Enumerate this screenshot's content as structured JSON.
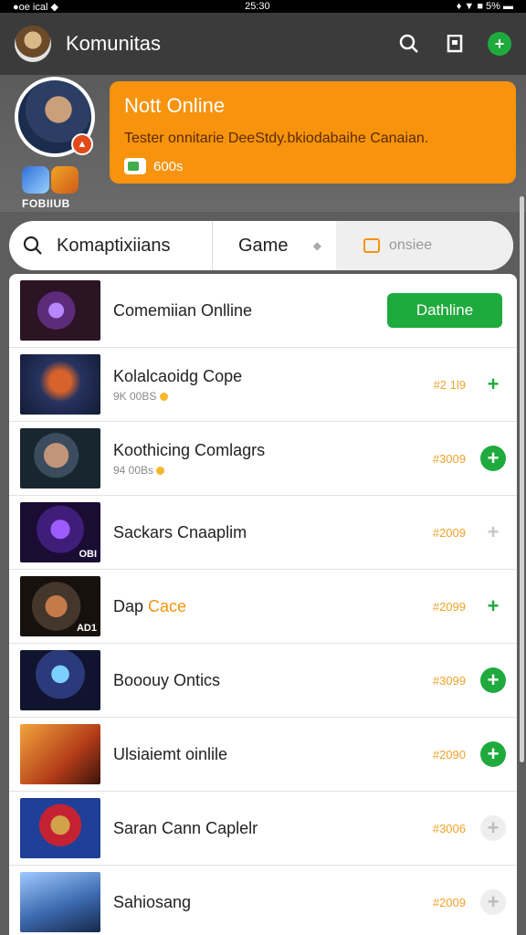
{
  "statusbar": {
    "left": "●oe ical ◆",
    "center": "25:30",
    "right": "♦ ▼ ■ 5% ▬"
  },
  "app": {
    "title": "Komunitas"
  },
  "header_icons": [
    "search-icon",
    "bookmark-icon",
    "add-icon"
  ],
  "profile": {
    "caption": "FOBIIUB",
    "badge_icon": "fire-icon"
  },
  "banner": {
    "title": "Nott Online",
    "text": "Tester onnitarie DeeStdy.bkiodabaihe Canaian.",
    "count": "600s"
  },
  "search": {
    "query": "Komaptixiians",
    "game_label": "Game",
    "caret": "◆",
    "online_label": "onsiee"
  },
  "list": [
    {
      "title": "Comemiian Onlline",
      "title_hl": "",
      "sub": "",
      "meta": "",
      "action": "Dathline",
      "action_type": "button",
      "thumb_tag": ""
    },
    {
      "title": "Kolalcaoidg Cope",
      "title_hl": "",
      "sub": "9K 00BS",
      "meta": "#2 1l9",
      "action": "+",
      "action_type": "plain",
      "thumb_tag": ""
    },
    {
      "title": "Koothicing Comlagrs",
      "title_hl": "",
      "sub": "94 00Bs",
      "meta": "#3009",
      "action": "+",
      "action_type": "filled",
      "thumb_tag": ""
    },
    {
      "title": "Sackars Cnaaplim",
      "title_hl": "",
      "sub": "",
      "meta": "#2009",
      "action": "+",
      "action_type": "grey",
      "thumb_tag": "OBI"
    },
    {
      "title": "Dap ",
      "title_hl": "Cace",
      "sub": "",
      "meta": "#2099",
      "action": "+",
      "action_type": "plain",
      "thumb_tag": "AD1"
    },
    {
      "title": "Booouy Ontics",
      "title_hl": "",
      "sub": "",
      "meta": "#3099",
      "action": "+",
      "action_type": "filled",
      "thumb_tag": ""
    },
    {
      "title": "Ulsiaiemt oinlile",
      "title_hl": "",
      "sub": "",
      "meta": "#2090",
      "action": "+",
      "action_type": "filled",
      "thumb_tag": ""
    },
    {
      "title": "Saran Cann Caplelr",
      "title_hl": "",
      "sub": "",
      "meta": "#3006",
      "action": "+",
      "action_type": "grey-filled",
      "thumb_tag": ""
    },
    {
      "title": "Sahiosang",
      "title_hl": "",
      "sub": "",
      "meta": "#2009",
      "action": "+",
      "action_type": "grey-filled",
      "thumb_tag": ""
    }
  ]
}
